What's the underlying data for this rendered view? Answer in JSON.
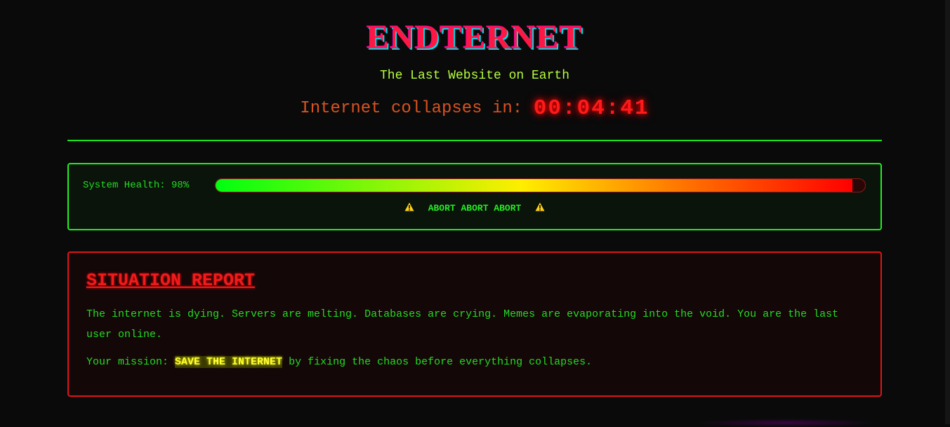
{
  "header": {
    "title": "ENDTERNET",
    "tagline": "The Last Website on Earth",
    "countdown_label": "Internet collapses in:",
    "countdown_value": "00:04:41"
  },
  "health": {
    "label": "System Health: 98%",
    "value_percent": 98,
    "warning_text": "ABORT ABORT ABORT",
    "icon": "warning-icon"
  },
  "report": {
    "heading": "SITUATION REPORT",
    "paragraph1": "The internet is dying. Servers are melting. Databases are crying. Memes are evaporating into the void. You are the last user online.",
    "mission_prefix": "Your mission: ",
    "mission_highlight": "SAVE THE INTERNET",
    "mission_suffix": " by fixing the chaos before everything collapses."
  },
  "colors": {
    "background": "#0a0a0b",
    "title_red": "#ff1744",
    "tagline_green": "#b6ff3b",
    "timer_red": "#ff1a1a",
    "terminal_green": "#22dd22",
    "panel_red": "#e01515",
    "highlight_yellow": "#ffff33"
  }
}
